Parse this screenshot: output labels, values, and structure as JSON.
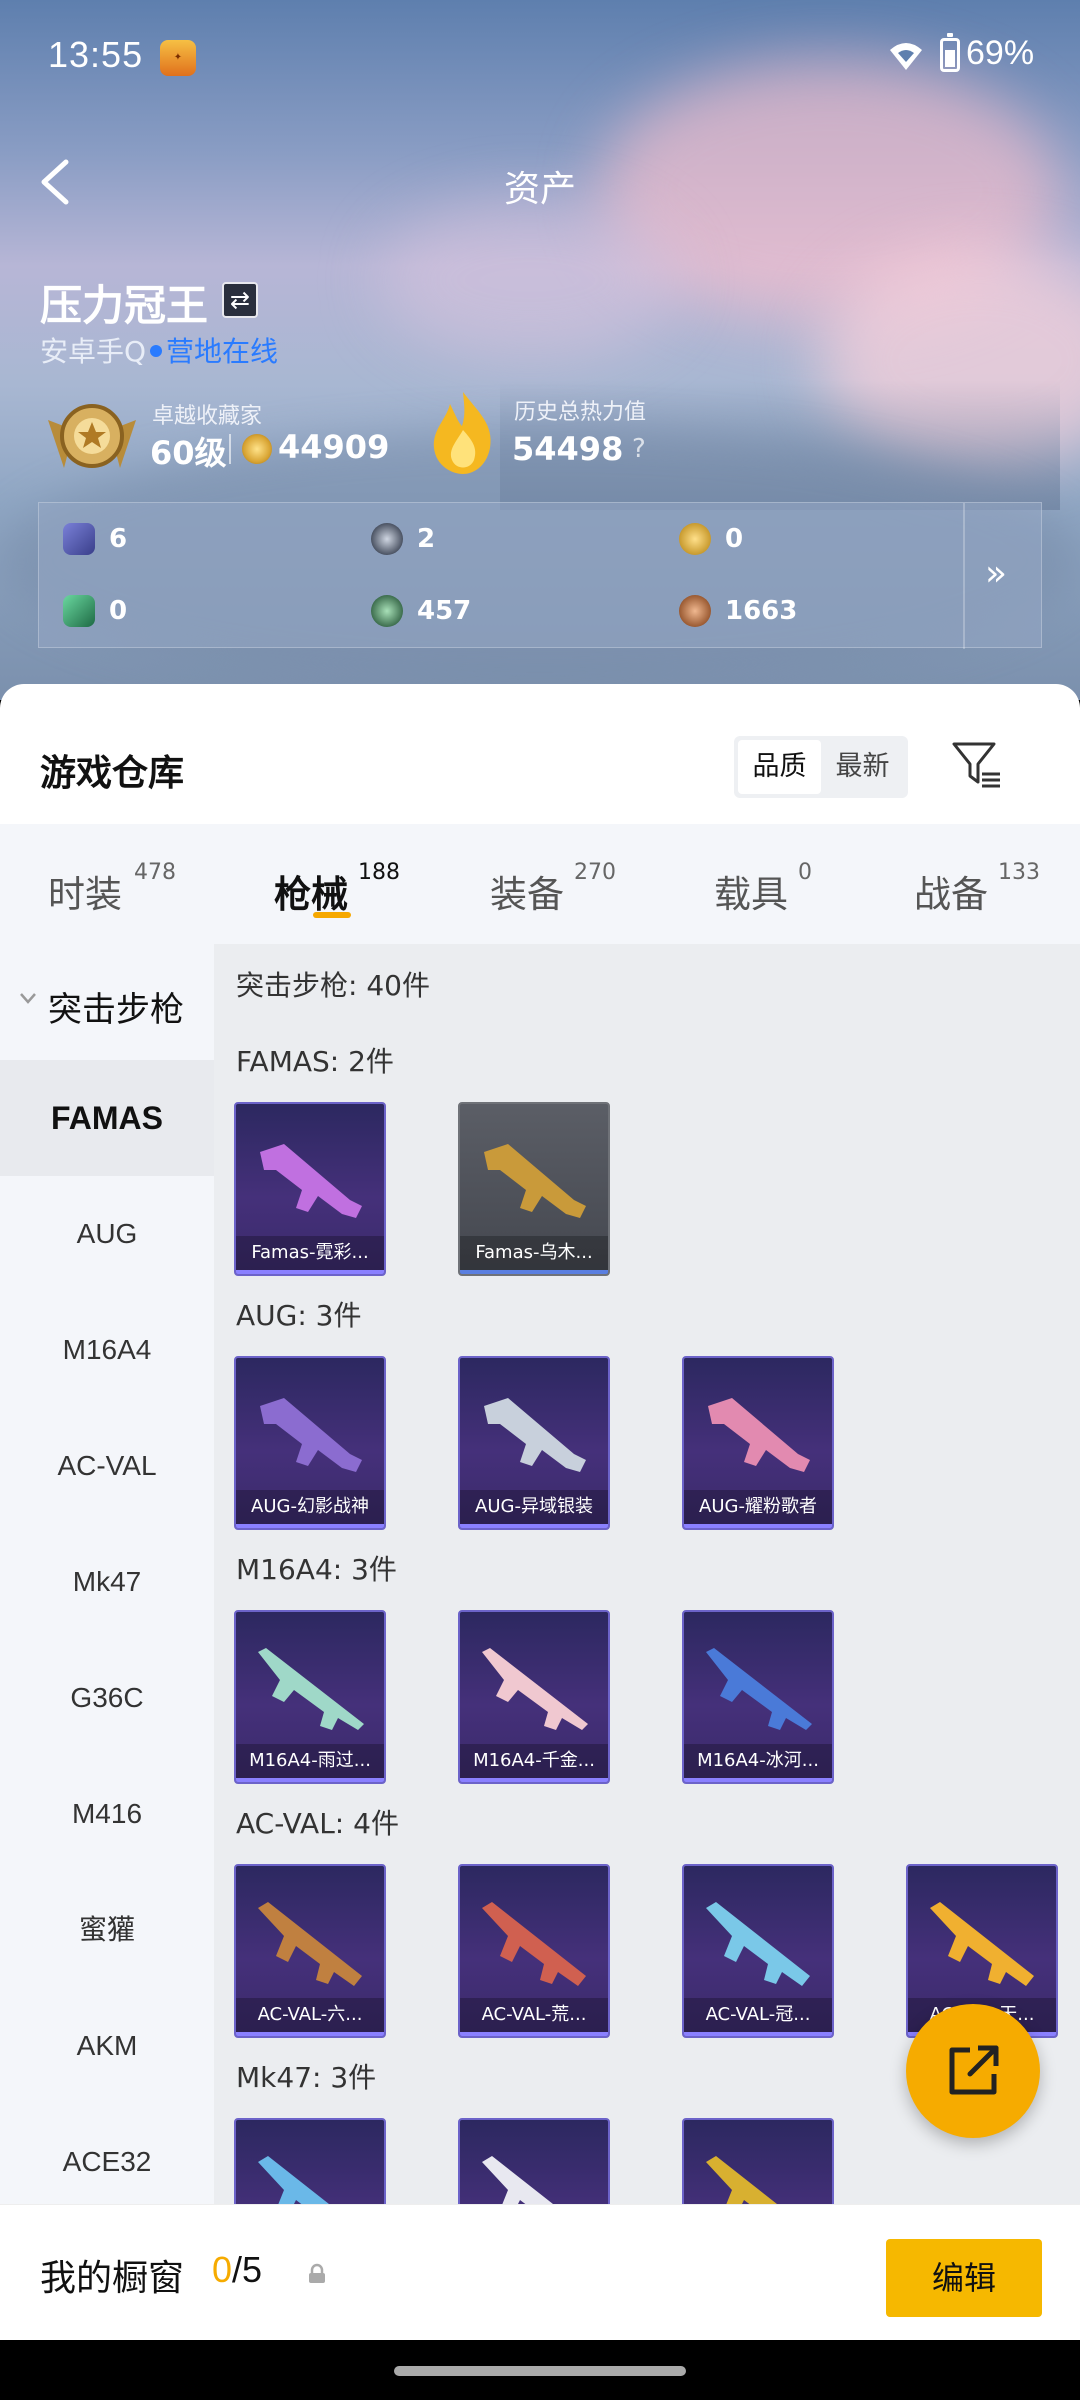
{
  "status_bar": {
    "time": "13:55",
    "battery": "69%"
  },
  "header": {
    "title": "资产"
  },
  "profile": {
    "name": "压力冠王",
    "platform": "安卓手Q",
    "online_status": "营地在线",
    "collector_label": "卓越收藏家",
    "collector_level": "60级",
    "collector_points": "44909",
    "heat_label": "历史总热力值",
    "heat_value": "54498",
    "help": "?"
  },
  "stats": [
    {
      "value": "6",
      "icon": "card-icon",
      "color": "#5a5fb0"
    },
    {
      "value": "2",
      "icon": "emblem-icon",
      "color": "#4b5363"
    },
    {
      "value": "0",
      "icon": "gold-emblem-icon",
      "color": "#c89a2e"
    },
    {
      "value": "0",
      "icon": "green-card-icon",
      "color": "#2e8a5a"
    },
    {
      "value": "457",
      "icon": "green-orb-icon",
      "color": "#3d6e4e"
    },
    {
      "value": "1663",
      "icon": "bronze-orb-icon",
      "color": "#9a5a32"
    }
  ],
  "warehouse": {
    "title": "游戏仓库",
    "sort": [
      "品质",
      "最新"
    ],
    "sort_active": "品质"
  },
  "tabs": [
    {
      "label": "时装",
      "count": "478"
    },
    {
      "label": "枪械",
      "count": "188"
    },
    {
      "label": "装备",
      "count": "270"
    },
    {
      "label": "载具",
      "count": "0"
    },
    {
      "label": "战备",
      "count": "133"
    }
  ],
  "active_tab": "枪械",
  "sidebar": {
    "category": "突击步枪",
    "items": [
      "FAMAS",
      "AUG",
      "M16A4",
      "AC-VAL",
      "Mk47",
      "G36C",
      "M416",
      "蜜獾",
      "AKM",
      "ACE32"
    ],
    "active": "FAMAS"
  },
  "content": {
    "header": "突击步枪: 40件",
    "groups": [
      {
        "title": "FAMAS: 2件",
        "items": [
          {
            "label": "Famas-霓彩...",
            "color": "#c070e0"
          },
          {
            "label": "Famas-乌木...",
            "color": "#c99a3a"
          }
        ]
      },
      {
        "title": "AUG: 3件",
        "items": [
          {
            "label": "AUG-幻影战神",
            "color": "#8b6cd0"
          },
          {
            "label": "AUG-异域银装",
            "color": "#c8d0dc"
          },
          {
            "label": "AUG-耀粉歌者",
            "color": "#e28ab0"
          }
        ]
      },
      {
        "title": "M16A4: 3件",
        "items": [
          {
            "label": "M16A4-雨过...",
            "color": "#9fd8c8"
          },
          {
            "label": "M16A4-千金...",
            "color": "#f0c8d0"
          },
          {
            "label": "M16A4-冰河...",
            "color": "#4a7ad8"
          }
        ]
      },
      {
        "title": "AC-VAL: 4件",
        "items": [
          {
            "label": "AC-VAL-六...",
            "color": "#c08040"
          },
          {
            "label": "AC-VAL-荒...",
            "color": "#d06050"
          },
          {
            "label": "AC-VAL-冠...",
            "color": "#7ac8e8"
          },
          {
            "label": "AC-VAL-天...",
            "color": "#f0b030"
          }
        ]
      },
      {
        "title": "Mk47: 3件",
        "items": [
          {
            "label": "",
            "color": "#6ab8e8"
          },
          {
            "label": "",
            "color": "#e8e8f0"
          },
          {
            "label": "",
            "color": "#d8b030"
          }
        ]
      }
    ]
  },
  "showcase": {
    "title": "我的橱窗",
    "current": "0",
    "total": "/5",
    "edit_label": "编辑"
  },
  "colors": {
    "accent": "#f6ab00",
    "link": "#2a7bff"
  }
}
